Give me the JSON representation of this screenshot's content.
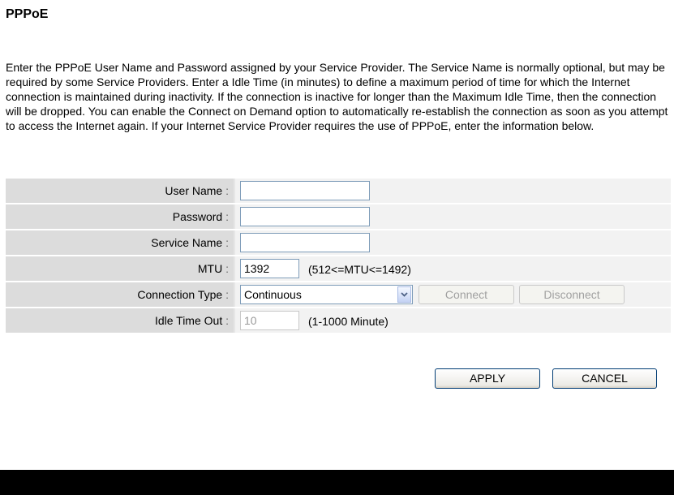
{
  "page": {
    "title": "PPPoE",
    "description": "Enter the PPPoE User Name and Password assigned by your Service Provider. The Service Name is normally optional, but may be required by some Service Providers. Enter a Idle Time (in minutes) to define a maximum period of time for which the Internet connection is maintained during inactivity. If the connection is inactive for longer than the Maximum Idle Time, then the connection will be dropped. You can enable the Connect on Demand option to automatically re-establish the connection as soon as you attempt to access the Internet again. If your Internet Service Provider requires the use of PPPoE, enter the information below."
  },
  "form": {
    "user_name": {
      "label": "User Name",
      "value": ""
    },
    "password": {
      "label": "Password",
      "value": ""
    },
    "service_name": {
      "label": "Service Name",
      "value": ""
    },
    "mtu": {
      "label": "MTU",
      "value": "1392",
      "hint": "(512<=MTU<=1492)"
    },
    "connection_type": {
      "label": "Connection Type",
      "selected": "Continuous",
      "connect_label": "Connect",
      "disconnect_label": "Disconnect"
    },
    "idle_time_out": {
      "label": "Idle Time Out",
      "value": "10",
      "hint": "(1-1000 Minute)"
    },
    "colon": ":"
  },
  "actions": {
    "apply_label": "APPLY",
    "cancel_label": "CANCEL"
  },
  "icons": {
    "dropdown": "chevron-down-icon"
  }
}
